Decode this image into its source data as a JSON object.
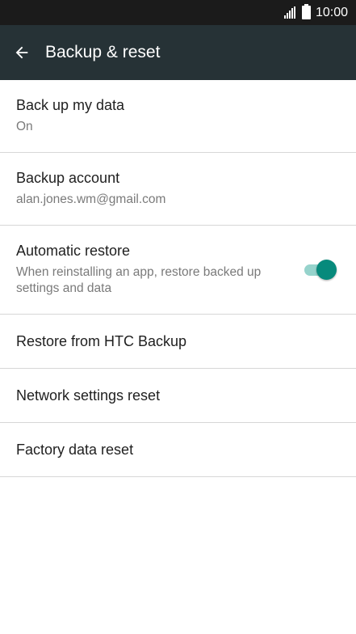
{
  "status_bar": {
    "time": "10:00",
    "icons": [
      "signal-icon",
      "battery-icon"
    ]
  },
  "app_bar": {
    "title": "Backup & reset",
    "back_icon": "arrow-left-icon"
  },
  "settings": {
    "back_up_my_data": {
      "title": "Back up my data",
      "subtitle": "On"
    },
    "backup_account": {
      "title": "Backup account",
      "subtitle": "alan.jones.wm@gmail.com"
    },
    "automatic_restore": {
      "title": "Automatic restore",
      "subtitle": "When reinstalling an app, restore backed up settings and data",
      "enabled": true
    },
    "restore_htc": {
      "title": "Restore from HTC Backup"
    },
    "network_reset": {
      "title": "Network settings reset"
    },
    "factory_reset": {
      "title": "Factory data reset"
    }
  },
  "colors": {
    "status_bar": "#1b1b1b",
    "app_bar": "#263236",
    "toggle_on": "#078a7c",
    "toggle_track": "#96d3cc"
  }
}
